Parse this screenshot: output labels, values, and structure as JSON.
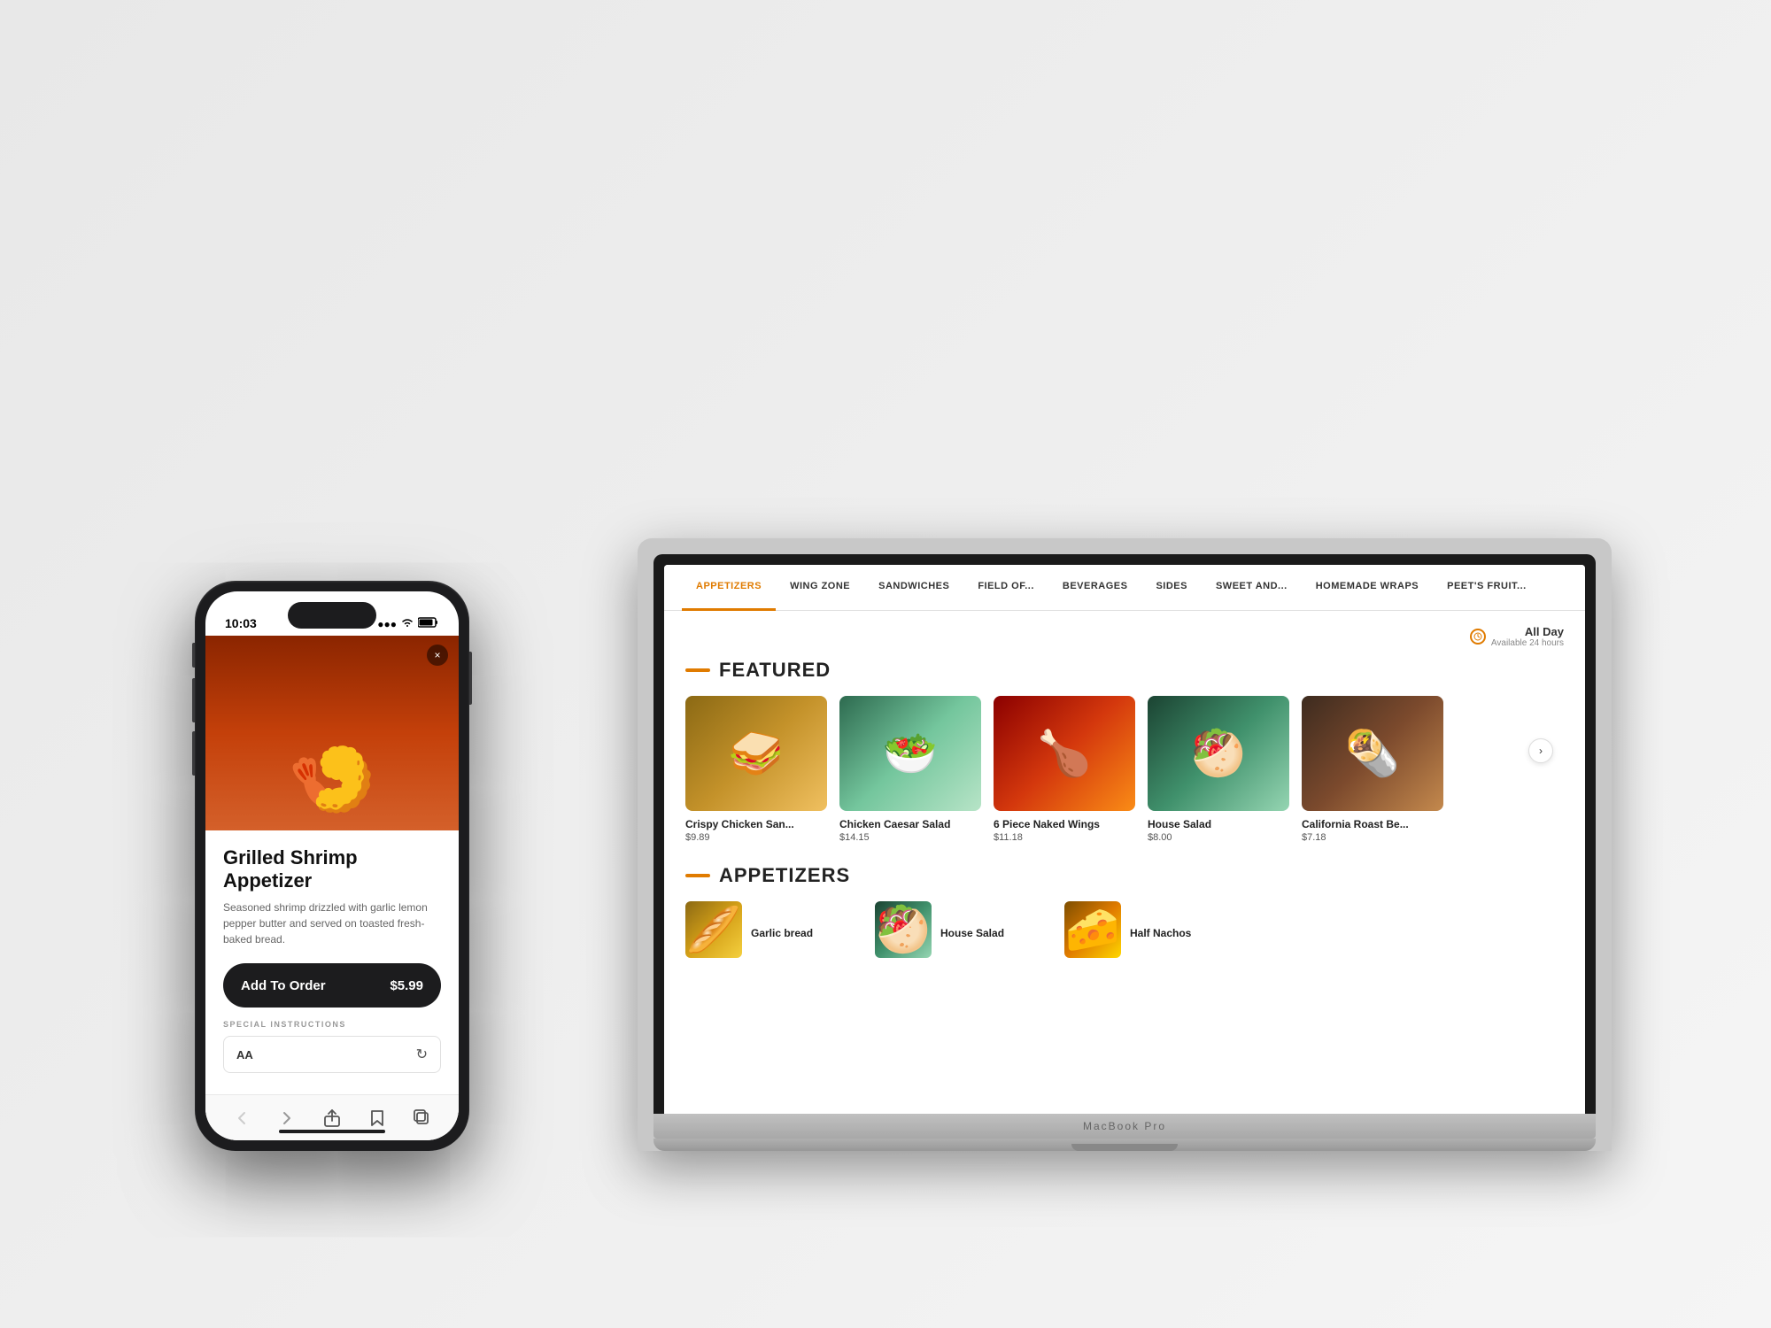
{
  "scene": {
    "background": "#f0f0f0"
  },
  "phone": {
    "status_time": "10:03",
    "signal": "●●●",
    "wifi": "wifi",
    "battery": "battery",
    "hero_emoji": "🍤",
    "close_label": "×",
    "item_name": "Grilled Shrimp Appetizer",
    "item_description": "Seasoned shrimp drizzled with garlic lemon pepper butter and served on toasted fresh-baked bread.",
    "add_btn_label": "Add To Order",
    "add_btn_price": "$5.99",
    "instructions_label": "SPECIAL INSTRUCTIONS",
    "aa_label": "AA",
    "bottom_nav": {
      "back": "‹",
      "forward": "›",
      "share": "share",
      "bookmarks": "bookmarks",
      "tabs": "tabs"
    }
  },
  "laptop": {
    "nav_items": [
      {
        "label": "APPETIZERS",
        "active": true
      },
      {
        "label": "WING ZONE",
        "active": false
      },
      {
        "label": "SANDWICHES",
        "active": false
      },
      {
        "label": "FIELD OF...",
        "active": false
      },
      {
        "label": "BEVERAGES",
        "active": false
      },
      {
        "label": "SIDES",
        "active": false
      },
      {
        "label": "SWEET AND...",
        "active": false
      },
      {
        "label": "HOMEMADE WRAPS",
        "active": false
      },
      {
        "label": "PEET'S FRUIT...",
        "active": false
      }
    ],
    "all_day_title": "All Day",
    "all_day_sub": "Available 24 hours",
    "featured_title": "FEATURED",
    "featured_items": [
      {
        "name": "Crispy Chicken San...",
        "price": "$9.89",
        "img_class": "img-crispy"
      },
      {
        "name": "Chicken Caesar Salad",
        "price": "$14.15",
        "img_class": "img-caesar"
      },
      {
        "name": "6 Piece Naked Wings",
        "price": "$11.18",
        "img_class": "img-wings"
      },
      {
        "name": "House Salad",
        "price": "$8.00",
        "img_class": "img-salad"
      },
      {
        "name": "California Roast Be...",
        "price": "$7.18",
        "img_class": "img-roast"
      }
    ],
    "appetizers_title": "APPETIZERS",
    "appetizer_items": [
      {
        "name": "Garlic bread",
        "img_class": "img-bread"
      },
      {
        "name": "House Salad",
        "img_class": "img-salad"
      },
      {
        "name": "Half Nachos",
        "img_class": "img-nachos"
      }
    ],
    "macbook_label": "MacBook Pro"
  }
}
